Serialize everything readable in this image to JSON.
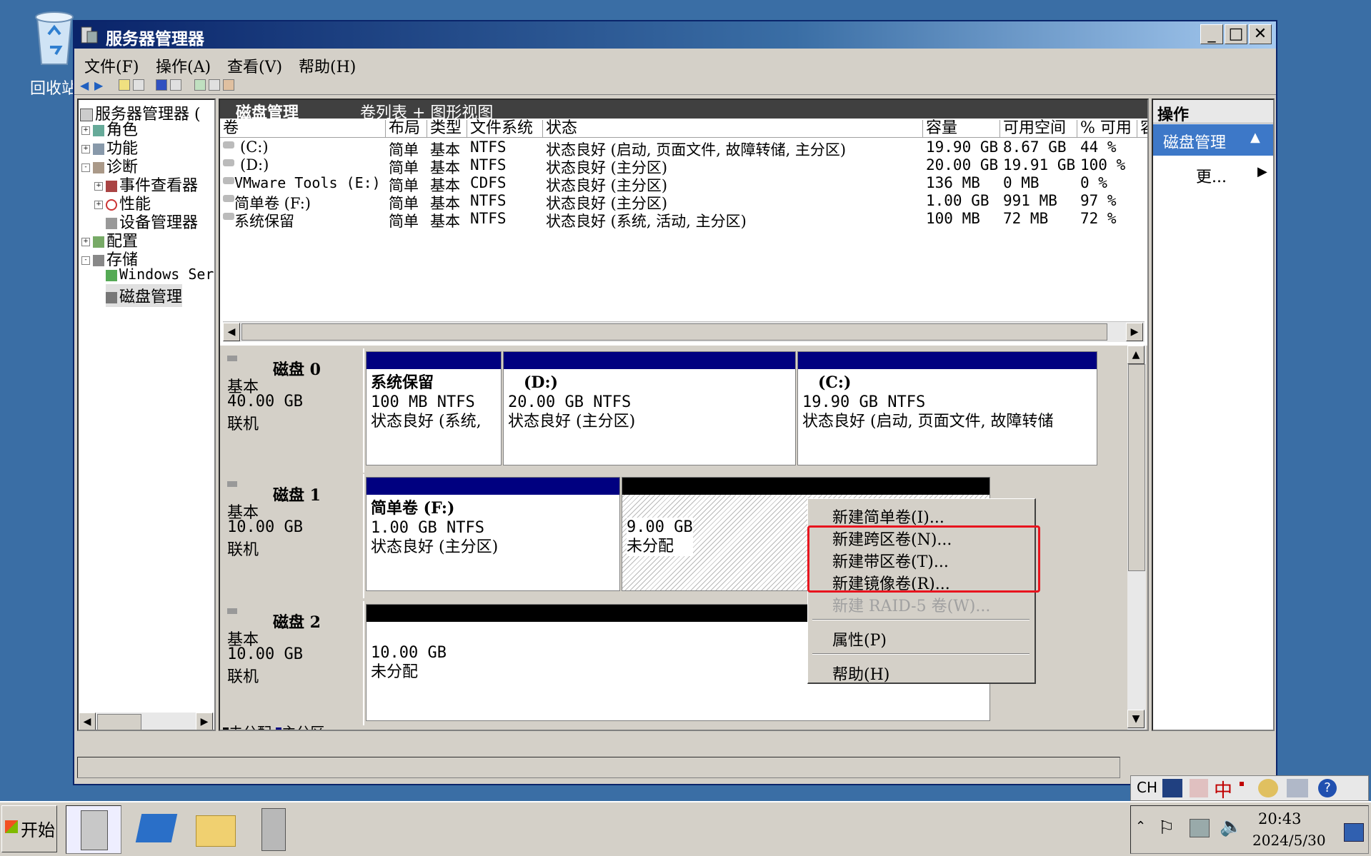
{
  "desktop": {
    "recycle_label": "回收站"
  },
  "window": {
    "title": "服务器管理器",
    "controls": {
      "minimize": "_",
      "maximize": "□",
      "close": "✕"
    },
    "menu": [
      "文件(F)",
      "操作(A)",
      "查看(V)",
      "帮助(H)"
    ]
  },
  "tree": {
    "root": "服务器管理器 (",
    "items": [
      {
        "label": "角色",
        "expander": "+"
      },
      {
        "label": "功能",
        "expander": "+"
      },
      {
        "label": "诊断",
        "expander": "-"
      },
      {
        "label": "事件查看器",
        "expander": "+"
      },
      {
        "label": "性能",
        "expander": "+"
      },
      {
        "label": "设备管理器",
        "expander": ""
      },
      {
        "label": "配置",
        "expander": "+"
      },
      {
        "label": "存储",
        "expander": "-"
      },
      {
        "label": "Windows Ser",
        "expander": ""
      },
      {
        "label": "磁盘管理",
        "expander": ""
      }
    ]
  },
  "center": {
    "title": "磁盘管理",
    "view": "卷列表 + 图形视图",
    "columns": [
      "卷",
      "布局",
      "类型",
      "文件系统",
      "状态",
      "容量",
      "可用空间",
      "% 可用",
      "容"
    ],
    "rows": [
      {
        "vol": "(C:)",
        "layout": "简单",
        "type": "基本",
        "fs": "NTFS",
        "status": "状态良好 (启动, 页面文件, 故障转储, 主分区)",
        "cap": "19.90 GB",
        "free": "8.67 GB",
        "pct": "44 %"
      },
      {
        "vol": "(D:)",
        "layout": "简单",
        "type": "基本",
        "fs": "NTFS",
        "status": "状态良好 (主分区)",
        "cap": "20.00 GB",
        "free": "19.91 GB",
        "pct": "100 %"
      },
      {
        "vol": "VMware Tools (E:)",
        "layout": "简单",
        "type": "基本",
        "fs": "CDFS",
        "status": "状态良好 (主分区)",
        "cap": "136 MB",
        "free": "0 MB",
        "pct": "0 %"
      },
      {
        "vol": "简单卷 (F:)",
        "layout": "简单",
        "type": "基本",
        "fs": "NTFS",
        "status": "状态良好 (主分区)",
        "cap": "1.00 GB",
        "free": "991 MB",
        "pct": "97 %"
      },
      {
        "vol": "系统保留",
        "layout": "简单",
        "type": "基本",
        "fs": "NTFS",
        "status": "状态良好 (系统, 活动, 主分区)",
        "cap": "100 MB",
        "free": "72 MB",
        "pct": "72 %"
      }
    ]
  },
  "disks": [
    {
      "name": "磁盘 0",
      "kind": "基本",
      "size": "40.00 GB",
      "state": "联机",
      "parts": [
        {
          "title": "系统保留",
          "size": "100 MB NTFS",
          "status": "状态良好 (系统,"
        },
        {
          "title": "(D:)",
          "size": "20.00 GB NTFS",
          "status": "状态良好 (主分区)"
        },
        {
          "title": "(C:)",
          "size": "19.90 GB NTFS",
          "status": "状态良好 (启动, 页面文件, 故障转储"
        }
      ]
    },
    {
      "name": "磁盘 1",
      "kind": "基本",
      "size": "10.00 GB",
      "state": "联机",
      "parts": [
        {
          "title": "简单卷  (F:)",
          "size": "1.00 GB NTFS",
          "status": "状态良好 (主分区)"
        },
        {
          "title": "",
          "size": "9.00 GB",
          "status": "未分配"
        }
      ]
    },
    {
      "name": "磁盘 2",
      "kind": "基本",
      "size": "10.00 GB",
      "state": "联机",
      "parts": [
        {
          "title": "",
          "size": "10.00 GB",
          "status": "未分配"
        }
      ]
    }
  ],
  "legend": {
    "unallocated": "未分配",
    "primary": "主分区"
  },
  "actions": {
    "header": "操作",
    "section": "磁盘管理",
    "more": "更..."
  },
  "context_menu": {
    "items": [
      "新建简单卷(I)...",
      "新建跨区卷(N)...",
      "新建带区卷(T)...",
      "新建镜像卷(R)...",
      "新建 RAID-5 卷(W)...",
      "属性(P)",
      "帮助(H)"
    ]
  },
  "taskbar": {
    "start": "开始",
    "ime": "CH",
    "ime_mode": "中",
    "time": "20:43",
    "date": "2024/5/30"
  },
  "colors": {
    "primary_bar": "#000080",
    "unalloc_bar": "#000000",
    "highlight": "#e8141e",
    "desktop": "#3a6ea5"
  }
}
